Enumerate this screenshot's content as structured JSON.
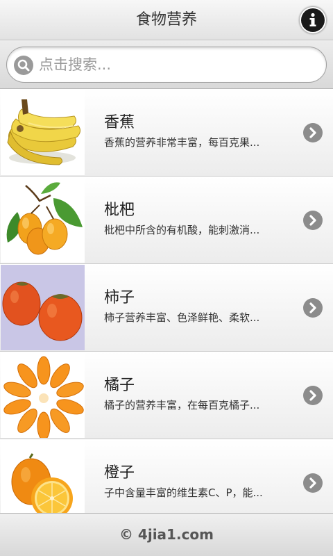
{
  "header": {
    "title": "食物营养",
    "info_icon": "info-icon"
  },
  "search": {
    "placeholder": "点击搜索...",
    "icon": "search-icon"
  },
  "items": [
    {
      "title": "香蕉",
      "desc": "香蕉的营养非常丰富，每百克果...",
      "image": "banana-image"
    },
    {
      "title": "枇杷",
      "desc": "枇杷中所含的有机酸，能刺激消...",
      "image": "loquat-image"
    },
    {
      "title": "柿子",
      "desc": "柿子营养丰富、色泽鲜艳、柔软...",
      "image": "persimmon-image"
    },
    {
      "title": "橘子",
      "desc": "橘子的营养丰富，在每百克橘子...",
      "image": "tangerine-image"
    },
    {
      "title": "橙子",
      "desc": "子中含量丰富的维生素C、P，能...",
      "image": "orange-image"
    }
  ],
  "footer": {
    "text": "© 4jia1.com"
  },
  "colors": {
    "header_bg": "#e9e9e9",
    "accent_dark": "#1a1a1a",
    "chevron": "#8c8c8c"
  }
}
